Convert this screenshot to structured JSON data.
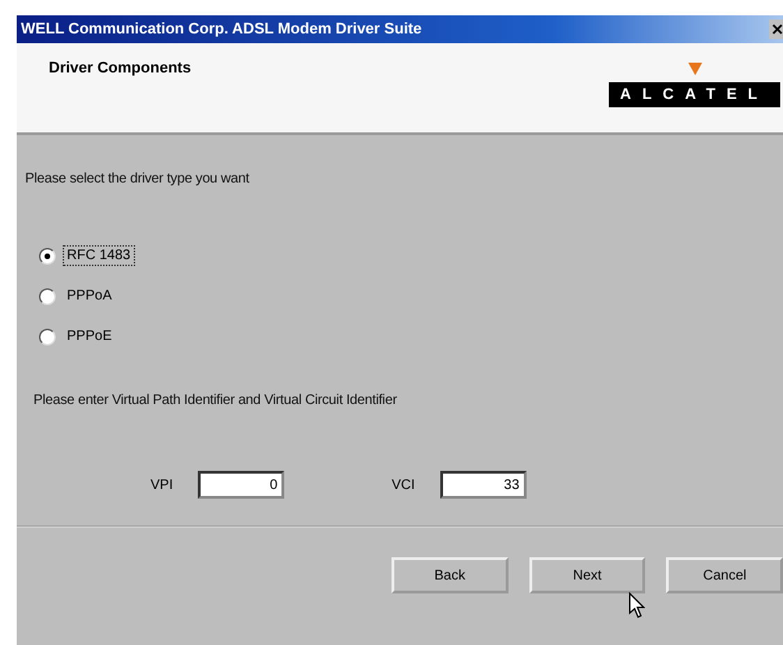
{
  "window": {
    "title": "WELL Communication Corp. ADSL Modem Driver Suite"
  },
  "header": {
    "title": "Driver Components",
    "logo": "ALCATEL"
  },
  "driver_prompt": "Please select the driver type you want",
  "driver_types": [
    {
      "label": "RFC 1483",
      "selected": true
    },
    {
      "label": "PPPoA",
      "selected": false
    },
    {
      "label": "PPPoE",
      "selected": false
    }
  ],
  "vc_prompt": "Please enter Virtual Path Identifier and Virtual Circuit Identifier",
  "fields": [
    {
      "label": "VPI",
      "value": "0"
    },
    {
      "label": "VCI",
      "value": "33"
    }
  ],
  "buttons": [
    "Back",
    "Next",
    "Cancel"
  ]
}
